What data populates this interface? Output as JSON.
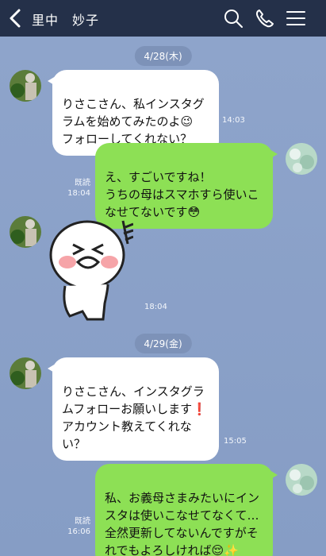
{
  "header": {
    "title": "里中　妙子",
    "icons": [
      "back-arrow-icon",
      "search-icon",
      "phone-icon",
      "menu-icon"
    ]
  },
  "dates": [
    "4/28(木)",
    "4/29(金)"
  ],
  "messages": [
    {
      "side": "in",
      "text": "りさこさん、私インスタグラムを始めてみたのよ😉\nフォローしてくれない？",
      "time": "14:03"
    },
    {
      "side": "out",
      "text": "え、すごいですね！\nうちの母はスマホすら使いこなせてないです😳",
      "read": "既読",
      "time": "18:04"
    },
    {
      "side": "in",
      "sticker": true,
      "time": "18:04"
    },
    {
      "side": "in",
      "text": "りさこさん、インスタグラムフォローお願いします❗\nアカウント教えてくれない？",
      "time": "15:05"
    },
    {
      "side": "out",
      "text": "私、お義母さまみたいにインスタは使いこなせてなくて…全然更新してないんですがそれでもよろしければ😌✨",
      "read": "既読",
      "time": "16:06"
    }
  ],
  "colors": {
    "header": "#243049",
    "background": "#8aa1c9",
    "outgoing_bubble": "#8de055",
    "incoming_bubble": "#ffffff"
  }
}
